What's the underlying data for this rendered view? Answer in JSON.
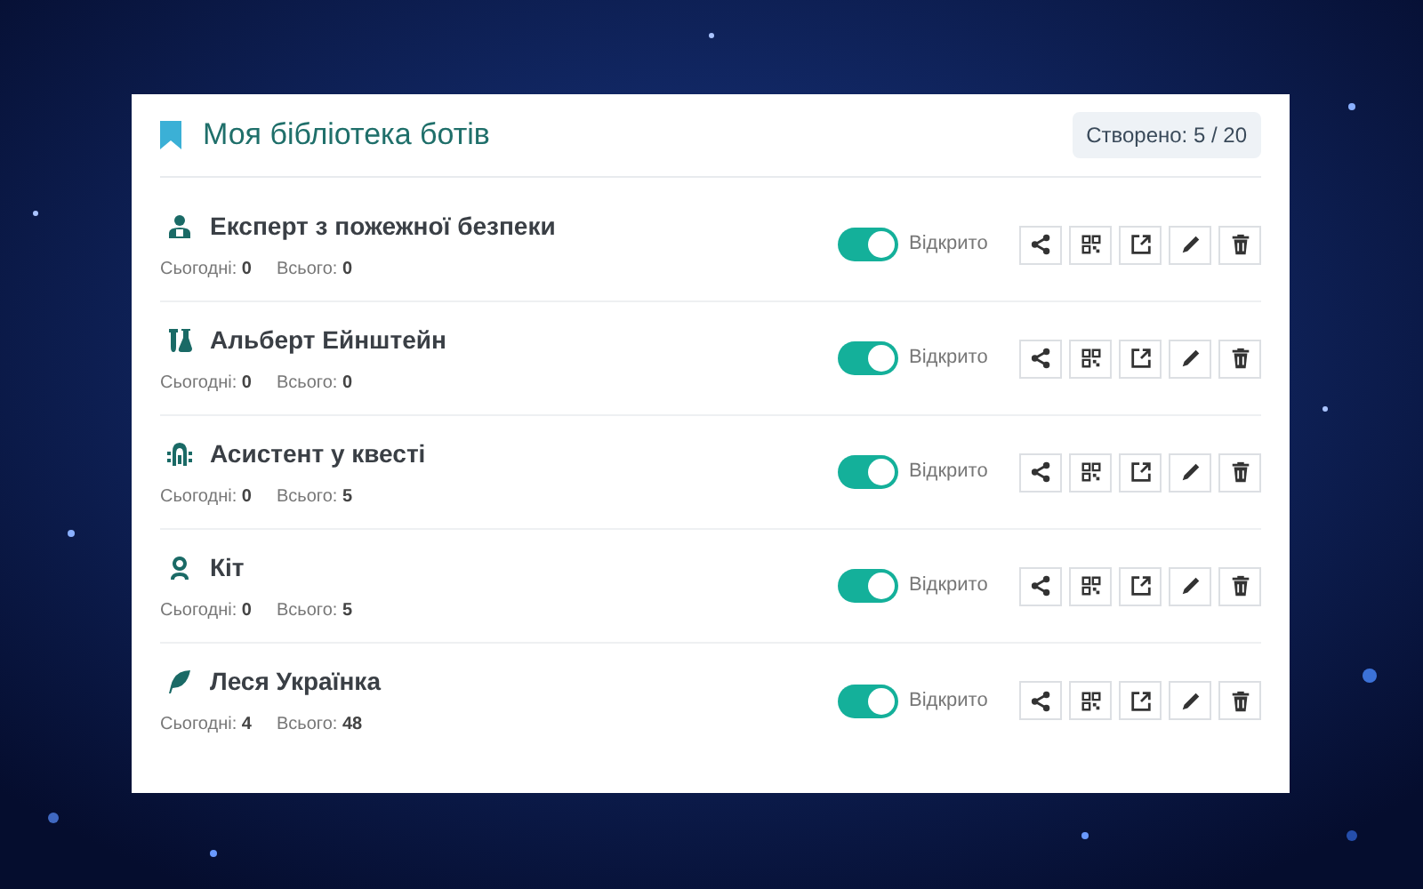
{
  "header": {
    "title": "Моя бібліотека ботів",
    "counter": "Створено: 5 / 20"
  },
  "bots": [
    {
      "name": "Експерт з пожежної безпеки",
      "today_label": "Сьогодні:",
      "today": "0",
      "total_label": "Всього:",
      "total": "0",
      "on": true,
      "status": "Відкрито"
    },
    {
      "name": "Альберт Ейнштейн",
      "today_label": "Сьогодні:",
      "today": "0",
      "total_label": "Всього:",
      "total": "0",
      "on": true,
      "status": "Відкрито"
    },
    {
      "name": "Асистент у квесті",
      "today_label": "Сьогодні:",
      "today": "0",
      "total_label": "Всього:",
      "total": "5",
      "on": true,
      "status": "Відкрито"
    },
    {
      "name": "Кіт",
      "today_label": "Сьогодні:",
      "today": "0",
      "total_label": "Всього:",
      "total": "5",
      "on": true,
      "status": "Відкрито"
    },
    {
      "name": "Леся Українка",
      "today_label": "Сьогодні:",
      "today": "4",
      "total_label": "Всього:",
      "total": "48",
      "on": true,
      "status": "Відкрито"
    }
  ]
}
